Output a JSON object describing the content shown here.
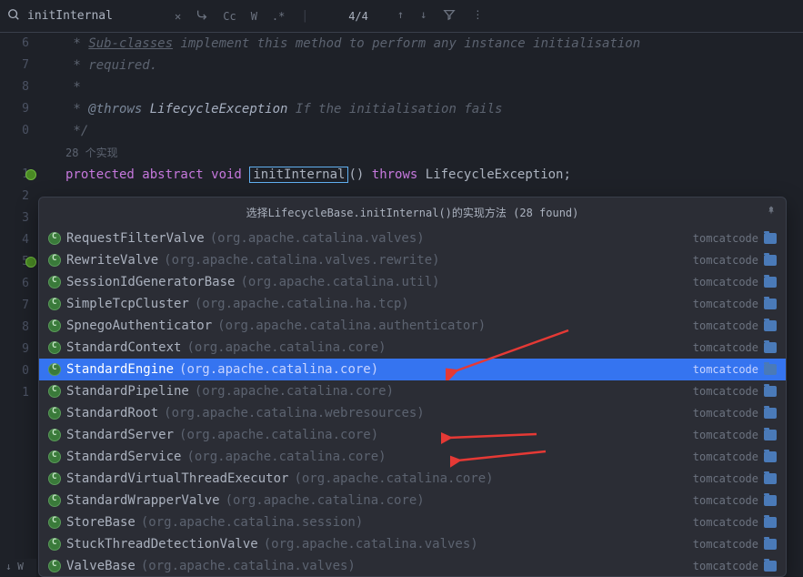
{
  "search": {
    "value": "initInternal",
    "cc_label": "Cc",
    "w_label": "W",
    "regex_label": ".*",
    "count": "4/4"
  },
  "gutter_lines": [
    "6",
    "7",
    "8",
    "9",
    "0",
    "",
    "1",
    "2",
    "3",
    "4",
    "5",
    "6",
    "7",
    "8",
    "9",
    "0",
    "1"
  ],
  "code": {
    "l0_a": " * ",
    "l0_b": "Sub-classes",
    "l0_c": " implement this method to perform any instance initialisation",
    "l1": " * required.",
    "l2": " *",
    "l3_a": " * ",
    "l3_b": "@throws",
    "l3_c": " LifecycleException ",
    "l3_d": "If the initialisation fails",
    "l4": " */",
    "l5": "28 个实现",
    "l6_a": "protected abstract void",
    "l6_b": "initInternal",
    "l6_c": "() ",
    "l6_d": "throws",
    "l6_e": " LifecycleException;"
  },
  "popup": {
    "title": "选择LifecycleBase.initInternal()的实现方法 (28 found)",
    "module": "tomcatcode",
    "items": [
      {
        "name": "RequestFilterValve",
        "pkg": "(org.apache.catalina.valves)",
        "selected": false
      },
      {
        "name": "RewriteValve",
        "pkg": "(org.apache.catalina.valves.rewrite)",
        "selected": false
      },
      {
        "name": "SessionIdGeneratorBase",
        "pkg": "(org.apache.catalina.util)",
        "selected": false
      },
      {
        "name": "SimpleTcpCluster",
        "pkg": "(org.apache.catalina.ha.tcp)",
        "selected": false
      },
      {
        "name": "SpnegoAuthenticator",
        "pkg": "(org.apache.catalina.authenticator)",
        "selected": false
      },
      {
        "name": "StandardContext",
        "pkg": "(org.apache.catalina.core)",
        "selected": false
      },
      {
        "name": "StandardEngine",
        "pkg": "(org.apache.catalina.core)",
        "selected": true
      },
      {
        "name": "StandardPipeline",
        "pkg": "(org.apache.catalina.core)",
        "selected": false
      },
      {
        "name": "StandardRoot",
        "pkg": "(org.apache.catalina.webresources)",
        "selected": false
      },
      {
        "name": "StandardServer",
        "pkg": "(org.apache.catalina.core)",
        "selected": false
      },
      {
        "name": "StandardService",
        "pkg": "(org.apache.catalina.core)",
        "selected": false
      },
      {
        "name": "StandardVirtualThreadExecutor",
        "pkg": "(org.apache.catalina.core)",
        "selected": false
      },
      {
        "name": "StandardWrapperValve",
        "pkg": "(org.apache.catalina.core)",
        "selected": false
      },
      {
        "name": "StoreBase",
        "pkg": "(org.apache.catalina.session)",
        "selected": false
      },
      {
        "name": "StuckThreadDetectionValve",
        "pkg": "(org.apache.catalina.valves)",
        "selected": false
      },
      {
        "name": "ValveBase",
        "pkg": "(org.apache.catalina.valves)",
        "selected": false
      }
    ]
  },
  "bottom_status": "W"
}
